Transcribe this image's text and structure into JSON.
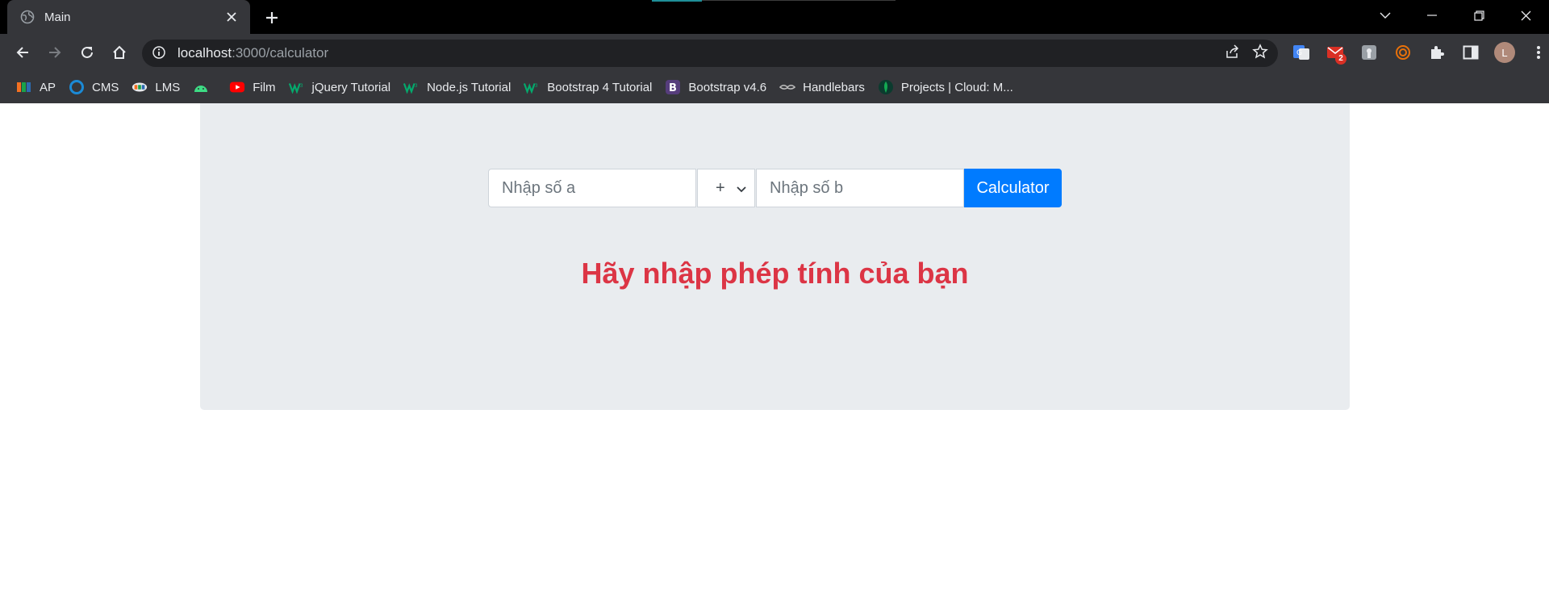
{
  "browser": {
    "tab": {
      "title": "Main"
    },
    "address": {
      "host": "localhost",
      "rest": ":3000/calculator"
    },
    "extension_badge": "2",
    "profile_initial": "L",
    "bookmarks": [
      {
        "label": "AP",
        "icon": "fpt-icon"
      },
      {
        "label": "CMS",
        "icon": "ring-icon"
      },
      {
        "label": "LMS",
        "icon": "lms-icon"
      },
      {
        "label": "",
        "icon": "android-icon"
      },
      {
        "label": "Film",
        "icon": "youtube-icon"
      },
      {
        "label": "jQuery Tutorial",
        "icon": "w3schools-icon"
      },
      {
        "label": "Node.js Tutorial",
        "icon": "w3schools-icon"
      },
      {
        "label": "Bootstrap 4 Tutorial",
        "icon": "w3schools-icon"
      },
      {
        "label": "Bootstrap v4.6",
        "icon": "bootstrap-icon"
      },
      {
        "label": "Handlebars",
        "icon": "handlebars-icon"
      },
      {
        "label": "Projects | Cloud: M...",
        "icon": "mongodb-icon"
      }
    ]
  },
  "calculator": {
    "input_a_placeholder": "Nhập số a",
    "operator_selected": "+",
    "input_b_placeholder": "Nhập số b",
    "button_label": "Calculator",
    "result_text": "Hãy nhập phép tính của bạn"
  },
  "colors": {
    "primary": "#007bff",
    "danger": "#dc3545",
    "jumbotron": "#e9ecef"
  }
}
